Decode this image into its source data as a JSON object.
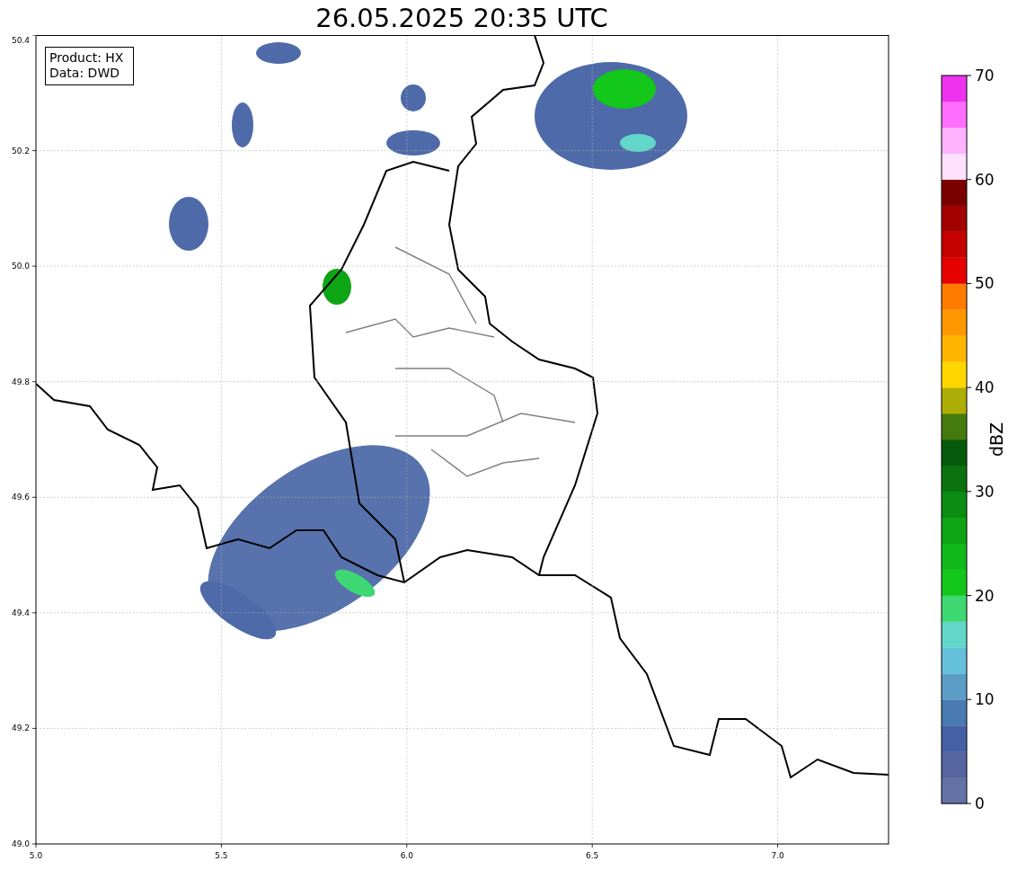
{
  "title": "26.05.2025 20:35 UTC",
  "annotation": [
    "Product: HX",
    "Data: DWD"
  ],
  "map": {
    "x_ticks": [
      "5.0",
      "5.5",
      "6.0",
      "6.5",
      "7.0"
    ],
    "y_ticks": [
      "50.4",
      "50.2",
      "50.0",
      "49.8",
      "49.6",
      "49.4",
      "49.2",
      "49.0"
    ]
  },
  "colorbar": {
    "label": "dBZ",
    "ticks": [
      "70",
      "60",
      "50",
      "40",
      "30",
      "20",
      "10",
      "0"
    ],
    "segments": [
      {
        "color": "#6373a6"
      },
      {
        "color": "#5565a0"
      },
      {
        "color": "#4660a5"
      },
      {
        "color": "#4a7ab2"
      },
      {
        "color": "#5b9dc7"
      },
      {
        "color": "#65c0dc"
      },
      {
        "color": "#62d6c9"
      },
      {
        "color": "#3ed872"
      },
      {
        "color": "#13c71b"
      },
      {
        "color": "#10b81a"
      },
      {
        "color": "#0ea515"
      },
      {
        "color": "#0b8c13"
      },
      {
        "color": "#0a7310"
      },
      {
        "color": "#075a0c"
      },
      {
        "color": "#457a0e"
      },
      {
        "color": "#aead05"
      },
      {
        "color": "#ffd700"
      },
      {
        "color": "#ffb400"
      },
      {
        "color": "#ff9800"
      },
      {
        "color": "#ff7c00"
      },
      {
        "color": "#e60000"
      },
      {
        "color": "#c40000"
      },
      {
        "color": "#a30000"
      },
      {
        "color": "#7a0000"
      },
      {
        "color": "#ffe0ff"
      },
      {
        "color": "#ffb3ff"
      },
      {
        "color": "#ff6eff"
      },
      {
        "color": "#ee33ee"
      }
    ]
  }
}
